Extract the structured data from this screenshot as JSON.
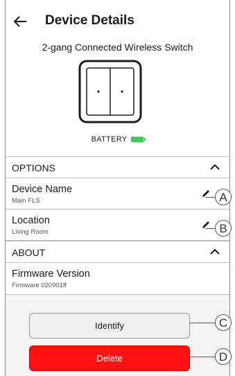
{
  "header": {
    "title": "Device Details"
  },
  "device": {
    "model": "2-gang Connected Wireless Switch",
    "battery_label": "BATTERY",
    "battery_color": "#3dcd58"
  },
  "options": {
    "section_label": "OPTIONS",
    "name_label": "Device Name",
    "name_value": "Main FLS",
    "location_label": "Location",
    "location_value": "Living Room"
  },
  "about": {
    "section_label": "ABOUT",
    "firmware_label": "Firmware Version",
    "firmware_value": "Firmware 020901ff"
  },
  "actions": {
    "identify_label": "Identify",
    "delete_label": "Delete",
    "delete_color": "#ff1212"
  },
  "callouts": [
    "A",
    "B",
    "C",
    "D"
  ]
}
